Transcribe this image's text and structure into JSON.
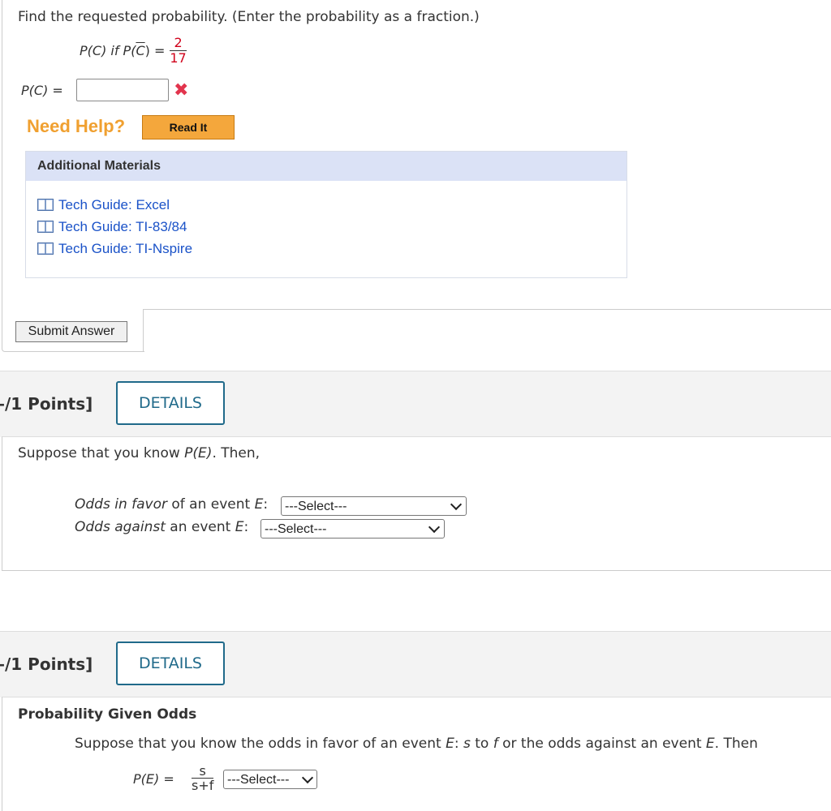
{
  "q1": {
    "instruction": "Find the requested probability. (Enter the probability as a fraction.)",
    "given_prefix": "P(C) if P(",
    "given_bar_letter": "C",
    "given_suffix": ") =",
    "given_num": "2",
    "given_den": "17",
    "answer_label": "P(C) =",
    "answer_value": "",
    "result_icon": "x-mark-icon",
    "need_help": "Need Help?",
    "read_it": "Read It",
    "additional_materials": {
      "title": "Additional Materials",
      "items": [
        "Tech Guide: Excel",
        "Tech Guide: TI-83/84",
        "Tech Guide: TI-Nspire"
      ]
    },
    "submit": "Submit Answer"
  },
  "q2": {
    "points": "–/1 Points]",
    "details": "DETAILS",
    "intro_prefix": "Suppose that you know ",
    "intro_pe": "P(E)",
    "intro_suffix": ". Then,",
    "row1_em": "Odds in favor",
    "row1_rest": " of an event ",
    "row1_var": "E",
    "row1_colon": ":",
    "row1_select": "---Select---",
    "row2_em": "Odds against",
    "row2_rest": " an event ",
    "row2_var": "E",
    "row2_colon": ":",
    "row2_select": "---Select---"
  },
  "q3": {
    "points": "–/1 Points]",
    "details": "DETAILS",
    "title": "Probability Given Odds",
    "text_a": "Suppose that you know the odds in favor of an event ",
    "text_e1": "E",
    "text_b": ": ",
    "text_s": "s",
    "text_c": " to ",
    "text_f": "f",
    "text_d": " or the odds against an event ",
    "text_e2": "E",
    "text_end": ". Then",
    "formula_label": "P(E) =",
    "formula_num": "s",
    "formula_den": "s+f",
    "select": "---Select---"
  },
  "colors": {
    "accent": "#206a8a",
    "help": "#f0a030",
    "link": "#1a52c8",
    "error": "#e2344d",
    "fraction": "#d0021b"
  }
}
